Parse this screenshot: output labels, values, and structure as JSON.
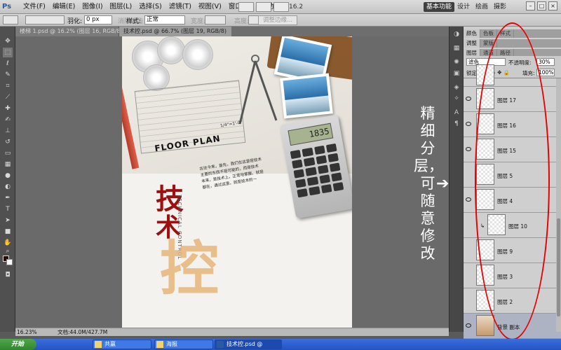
{
  "app": {
    "logo": "Ps"
  },
  "menu": [
    "文件(F)",
    "编辑(E)",
    "图像(I)",
    "图层(L)",
    "选择(S)",
    "滤镜(T)",
    "视图(V)",
    "窗口(W)",
    "帮助(H)"
  ],
  "menu_zoom": "16.2",
  "workspaces": [
    "基本功能",
    "设计",
    "绘画",
    "摄影"
  ],
  "window_controls": [
    "–",
    "□",
    "×"
  ],
  "options": {
    "feather_label": "羽化:",
    "feather_value": "0 px",
    "antialias_label": "消除锯齿",
    "style_label": "样式:",
    "style_value": "正常",
    "width_label": "宽度:",
    "height_label": "高度:",
    "refine_button": "调整边缘..."
  },
  "tabs": [
    {
      "label": "楼梯 1.psd @ 16.2% (图层 16, RGB/8)",
      "active": false
    },
    {
      "label": "技术控.psd @ 66.7% (图层 19, RGB/8)",
      "active": true
    }
  ],
  "document": {
    "heading_en": "FLOOR PLAN",
    "scale_note": "1/4\"=1'-0\"",
    "calc_display": "1835",
    "title_line1": "技",
    "title_line2": "术",
    "title_big": "控",
    "subtitle_en": "TECHNICAL CONTROL",
    "body_lines": [
      "古往今来，首先，我们在这里是技术",
      "主要的东西不是可能的，而是技术",
      "本来，是技术上，正常地掌握，就是",
      "都在，通过这里，就是技术的一"
    ]
  },
  "annotation": {
    "text": "精细分层，可随意修改",
    "arrow": "➔"
  },
  "panel": {
    "tabs_row1": [
      "颜色",
      "色板",
      "样式"
    ],
    "tabs_row2": [
      "调整",
      "蒙版"
    ],
    "tabs_row3": [
      "图层",
      "通道",
      "路径"
    ],
    "blend_mode": "滤色",
    "opacity_label": "不透明度:",
    "opacity_value": "30%",
    "lock_label": "锁定:",
    "fill_label": "填充:",
    "fill_value": "100%",
    "layers": [
      {
        "name": "",
        "visible": true,
        "selected": false
      },
      {
        "name": "图层 17",
        "visible": true,
        "selected": false
      },
      {
        "name": "图层 16",
        "visible": true,
        "selected": false
      },
      {
        "name": "图层 15",
        "visible": true,
        "selected": false
      },
      {
        "name": "图层 5",
        "visible": false,
        "selected": false
      },
      {
        "name": "图层 4",
        "visible": true,
        "selected": false
      },
      {
        "name": "图层 10",
        "visible": false,
        "selected": false
      },
      {
        "name": "图层 9",
        "visible": false,
        "selected": false
      },
      {
        "name": "图层 3",
        "visible": false,
        "selected": false
      },
      {
        "name": "图层 2",
        "visible": false,
        "selected": false
      },
      {
        "name": "背景 副本",
        "visible": true,
        "selected": true
      }
    ]
  },
  "status": {
    "zoom": "16.23%",
    "doc_info": "文档:44.0M/427.7M"
  },
  "taskbar": {
    "start": "开始",
    "items": [
      {
        "label": "共赢",
        "active": false
      },
      {
        "label": "海报",
        "active": false
      },
      {
        "label": "技术控.psd @ 16.3%",
        "active": true
      }
    ]
  },
  "colors": {
    "annotation_ring": "#e60000",
    "title_red": "#9b1010",
    "title_orange": "#e6b57a"
  }
}
